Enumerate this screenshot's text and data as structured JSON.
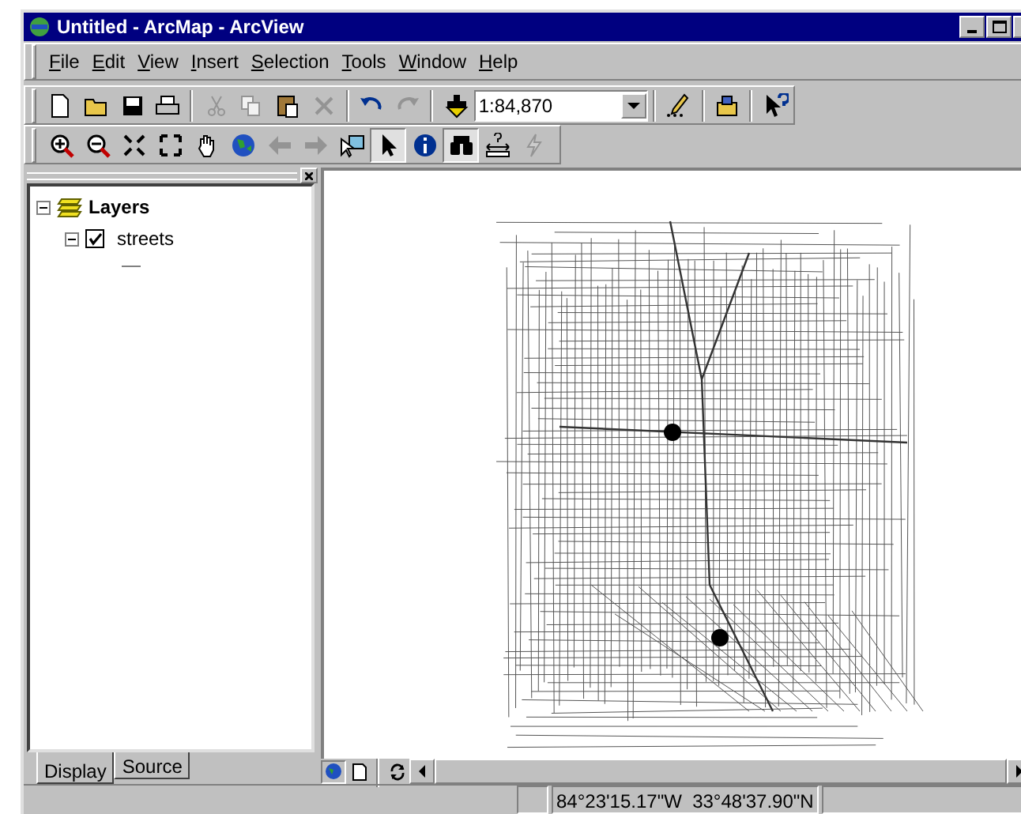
{
  "window": {
    "title": "Untitled - ArcMap - ArcView"
  },
  "menu": [
    {
      "label": "File"
    },
    {
      "label": "Edit"
    },
    {
      "label": "View"
    },
    {
      "label": "Insert"
    },
    {
      "label": "Selection"
    },
    {
      "label": "Tools"
    },
    {
      "label": "Window"
    },
    {
      "label": "Help"
    }
  ],
  "standard_toolbar": [
    {
      "kind": "new",
      "disabled": false
    },
    {
      "kind": "open",
      "disabled": false
    },
    {
      "kind": "save",
      "disabled": false
    },
    {
      "kind": "print",
      "disabled": false
    },
    {
      "kind": "sep"
    },
    {
      "kind": "cut",
      "disabled": true
    },
    {
      "kind": "copy",
      "disabled": true
    },
    {
      "kind": "paste",
      "disabled": false
    },
    {
      "kind": "delete",
      "disabled": true
    },
    {
      "kind": "sep"
    },
    {
      "kind": "undo",
      "disabled": false
    },
    {
      "kind": "redo",
      "disabled": true
    },
    {
      "kind": "sep"
    },
    {
      "kind": "add",
      "disabled": false
    },
    {
      "kind": "scale"
    },
    {
      "kind": "sep"
    },
    {
      "kind": "editor",
      "disabled": false
    },
    {
      "kind": "sep"
    },
    {
      "kind": "toolbox",
      "disabled": false
    },
    {
      "kind": "sep"
    },
    {
      "kind": "help",
      "disabled": false
    }
  ],
  "scale": {
    "value": "1:84,870"
  },
  "tools_toolbar": [
    {
      "kind": "zoomin",
      "disabled": false,
      "selected": false
    },
    {
      "kind": "zoomout",
      "disabled": false,
      "selected": false
    },
    {
      "kind": "fixedin",
      "disabled": false,
      "selected": false
    },
    {
      "kind": "fixedout",
      "disabled": false,
      "selected": false
    },
    {
      "kind": "pan",
      "disabled": false,
      "selected": false
    },
    {
      "kind": "globe",
      "disabled": false,
      "selected": false
    },
    {
      "kind": "back",
      "disabled": true,
      "selected": false
    },
    {
      "kind": "forward",
      "disabled": true,
      "selected": false
    },
    {
      "kind": "selectfeatures",
      "disabled": false,
      "selected": false
    },
    {
      "kind": "pointer",
      "disabled": false,
      "selected": true
    },
    {
      "kind": "identify",
      "disabled": false,
      "selected": false
    },
    {
      "kind": "find",
      "disabled": false,
      "selected": true
    },
    {
      "kind": "measure",
      "disabled": false,
      "selected": false
    },
    {
      "kind": "hyperlink",
      "disabled": true,
      "selected": false
    }
  ],
  "toc": {
    "layers": [
      {
        "label": "Layers",
        "expanded": true,
        "children": [
          {
            "label": "streets",
            "expanded": true,
            "checked": true
          }
        ]
      }
    ]
  },
  "toc_tabs": [
    {
      "label": "Display",
      "selected": true
    },
    {
      "label": "Source",
      "selected": false
    }
  ],
  "status_bar": {
    "coordinates": "84°23'15.17\"W  33°48'37.90\"N"
  }
}
